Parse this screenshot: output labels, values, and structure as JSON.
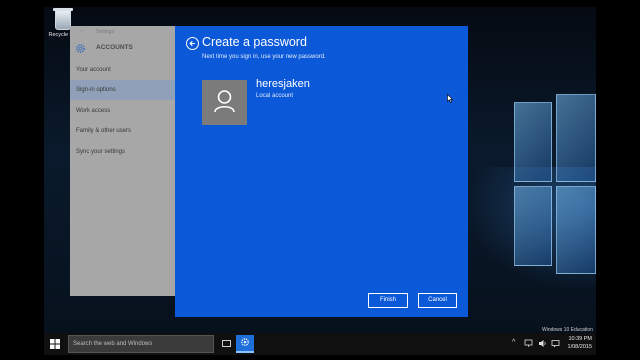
{
  "desktop": {
    "recycle_bin_label": "Recycle Bin",
    "watermark": "Windows 10 Education"
  },
  "settings": {
    "window_title": "Settings",
    "section_title": "ACCOUNTS",
    "nav_items": [
      {
        "label": "Your account",
        "selected": false
      },
      {
        "label": "Sign-in options",
        "selected": true
      },
      {
        "label": "Work access",
        "selected": false
      },
      {
        "label": "Family & other users",
        "selected": false
      },
      {
        "label": "Sync your settings",
        "selected": false
      }
    ]
  },
  "dialog": {
    "title": "Create a password",
    "subtitle": "Next time you sign in, use your new password.",
    "username": "heresjaken",
    "account_type": "Local account",
    "finish_label": "Finish",
    "cancel_label": "Cancel",
    "accent_color": "#0b59d8"
  },
  "taskbar": {
    "search_placeholder": "Search the web and Windows",
    "time": "10:39 PM",
    "date": "1/08/2015"
  },
  "icons": [
    "windows-start-icon",
    "task-view-icon",
    "settings-gear-icon",
    "tray-chevron-icon",
    "network-icon",
    "volume-icon",
    "notification-icon",
    "user-avatar-icon",
    "back-arrow-icon"
  ]
}
